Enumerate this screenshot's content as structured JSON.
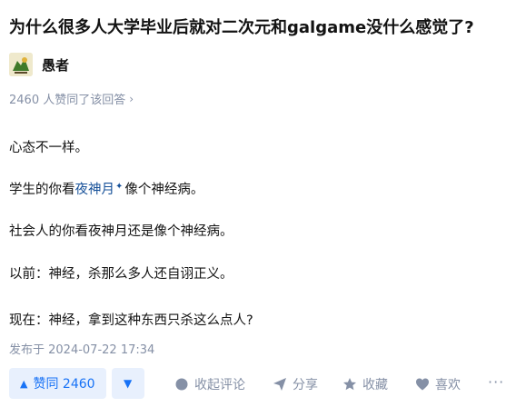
{
  "question": {
    "title": "为什么很多人大学毕业后就对二次元和galgame没什么感觉了?"
  },
  "author": {
    "name": "愚者",
    "avatar_icon": "avatar-image"
  },
  "answer": {
    "votes_text": "2460 人赞同了该回答",
    "votes_chevron": "›",
    "paragraphs": {
      "p1": "心态不一样。",
      "p2_before": "学生的你看",
      "p2_link": "夜神月",
      "p2_after": "像个神经病。",
      "p3": "社会人的你看夜神月还是像个神经病。",
      "p4": "以前：神经，杀那么多人还自诩正义。",
      "p5": "现在：神经，拿到这种东西只杀这么点人?"
    },
    "published": "发布于 2024-07-22 17:34"
  },
  "actions": {
    "upvote_label": "赞同 2460",
    "upvote_arrow": "▲",
    "downvote_arrow": "▼",
    "comment_label": "收起评论",
    "share_label": "分享",
    "favorite_label": "收藏",
    "like_label": "喜欢",
    "more_label": "···"
  },
  "colors": {
    "accent": "#1772f6",
    "link": "#175199",
    "muted": "#8590a6",
    "vote_bg": "#e8f0fd"
  }
}
